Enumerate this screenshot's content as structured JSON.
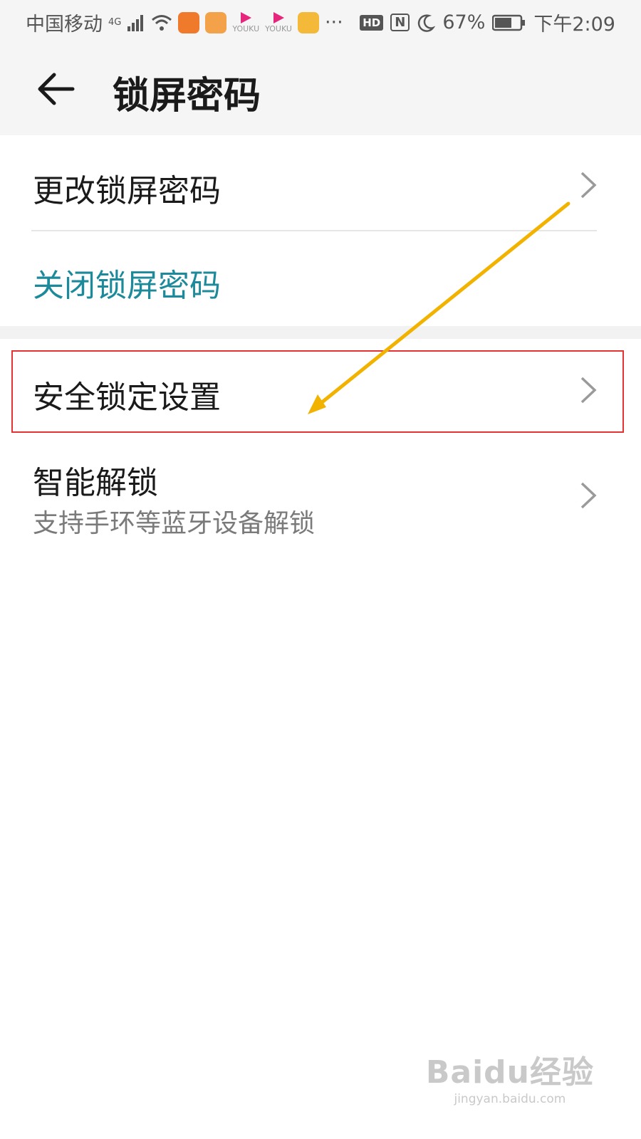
{
  "status_bar": {
    "carrier": "中国移动",
    "network": "4G",
    "app_icons": [
      "app-icon-orange",
      "uc-browser-icon",
      "youku-icon",
      "youku-icon",
      "cup-app-icon"
    ],
    "app_icon_labels": [
      "YOUKU",
      "YOUKU"
    ],
    "more": "···",
    "hd_badge": "HD",
    "nfc_badge": "N",
    "battery": "67%",
    "time": "下午2:09",
    "colors": {
      "orange": "#f07a2b",
      "youku_pink": "#e6267c",
      "cup_yellow": "#f5b93a"
    }
  },
  "header": {
    "title": "锁屏密码",
    "back_icon": "back-arrow-icon"
  },
  "items": [
    {
      "title": "更改锁屏密码",
      "icon": "chevron-right-icon"
    },
    {
      "title": "关闭锁屏密码",
      "color": "#1c8a9a"
    },
    {
      "title": "安全锁定设置",
      "icon": "chevron-right-icon"
    },
    {
      "title": "智能解锁",
      "subtitle": "支持手环等蓝牙设备解锁",
      "icon": "chevron-right-icon"
    }
  ],
  "annotation": {
    "highlight_color": "#e33333",
    "arrow_color": "#f2b200"
  },
  "watermark": {
    "main": "Baidu经验",
    "sub": "jingyan.baidu.com"
  }
}
